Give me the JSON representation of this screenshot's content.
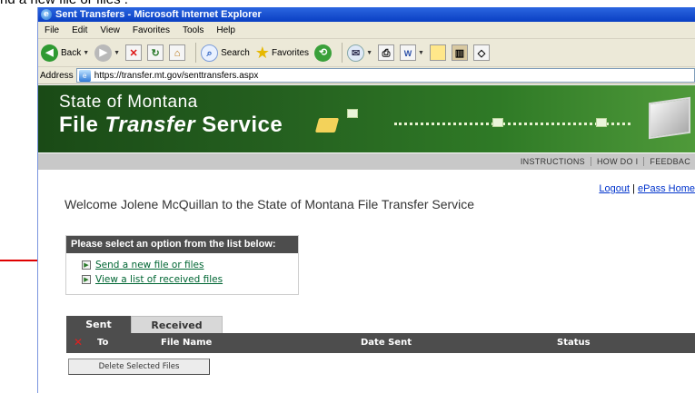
{
  "caption_top": "nd a new file or files .",
  "window": {
    "title": "Sent Transfers - Microsoft Internet Explorer",
    "menu": [
      "File",
      "Edit",
      "View",
      "Favorites",
      "Tools",
      "Help"
    ],
    "toolbar": {
      "back_label": "Back",
      "search_label": "Search",
      "favorites_label": "Favorites"
    },
    "address": {
      "label": "Address",
      "url": "https://transfer.mt.gov/senttransfers.aspx"
    }
  },
  "banner": {
    "line1": "State of Montana",
    "line2_a": "File ",
    "line2_b": "Transfer",
    "line2_c": " Service"
  },
  "nav": [
    "INSTRUCTIONS",
    "HOW DO I",
    "FEEDBAC"
  ],
  "toplinks": {
    "logout": "Logout",
    "separator": " | ",
    "epass": "ePass Home"
  },
  "welcome": "Welcome Jolene McQuillan to the State of Montana File Transfer Service",
  "options": {
    "header": "Please select an option from the list below:",
    "items": [
      "Send a new file or files",
      "View a list of received files"
    ]
  },
  "tabs": [
    "Sent",
    "Received"
  ],
  "table": {
    "columns": [
      "To",
      "File Name",
      "Date Sent",
      "Status"
    ]
  },
  "delete_button": "Delete Selected Files",
  "colors": {
    "banner_green": "#245f1f",
    "header_gray": "#4d4d4d",
    "arrow_red": "#e00000",
    "link_green": "#006633"
  }
}
